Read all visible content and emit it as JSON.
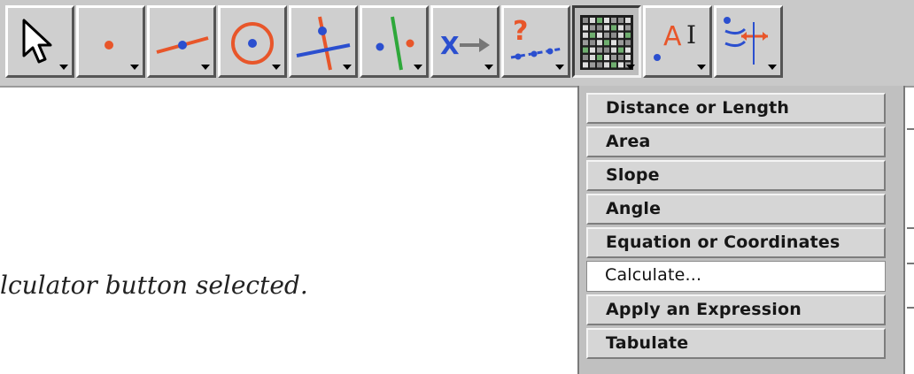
{
  "toolbar": {
    "tools": [
      {
        "name": "arrow-tool",
        "icon": "arrow-pointer-icon"
      },
      {
        "name": "point-tool",
        "icon": "point-icon"
      },
      {
        "name": "segment-tool",
        "icon": "segment-icon"
      },
      {
        "name": "circle-tool",
        "icon": "circle-icon"
      },
      {
        "name": "perpendicular-tool",
        "icon": "perpendicular-icon"
      },
      {
        "name": "reflect-tool",
        "icon": "reflect-icon"
      },
      {
        "name": "transform-tool",
        "icon": "transform-icon"
      },
      {
        "name": "locus-tool",
        "icon": "locus-icon"
      },
      {
        "name": "calculator-tool",
        "icon": "calculator-icon",
        "active": true
      },
      {
        "name": "text-tool",
        "icon": "text-label-icon"
      },
      {
        "name": "custom-tool",
        "icon": "custom-tool-icon"
      }
    ],
    "transform_glyph": "X",
    "locus_glyph": "?",
    "text_glyph": "A",
    "text_cursor_glyph": "I"
  },
  "menu": {
    "items": [
      "Distance or Length",
      "Area",
      "Slope",
      "Angle",
      "Equation or Coordinates",
      "Calculate...",
      "Apply an Expression",
      "Tabulate"
    ],
    "selected_index": 5
  },
  "caption": "lculator button selected.",
  "colors": {
    "orange": "#e8562a",
    "blue": "#2b4fcf",
    "green": "#2ea83a",
    "gray": "#777777"
  }
}
